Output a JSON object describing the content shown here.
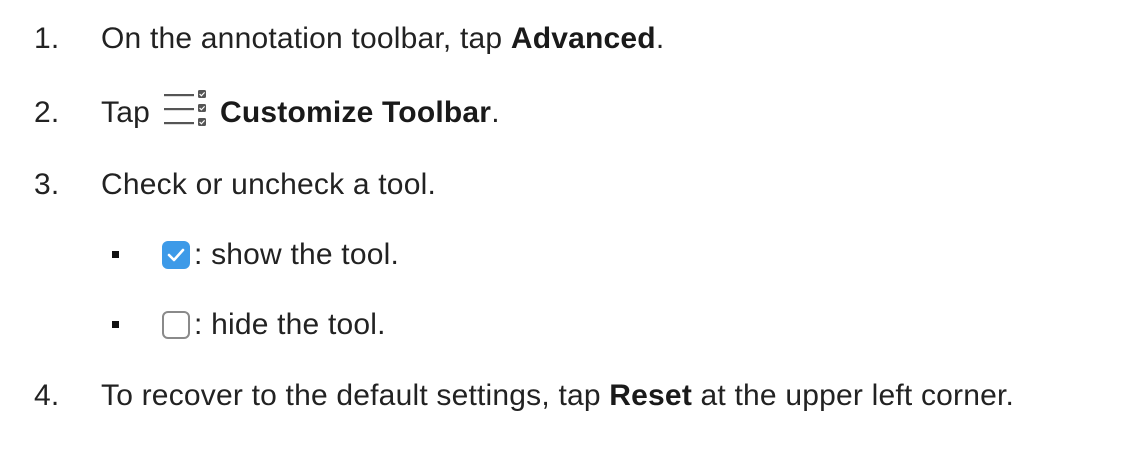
{
  "steps": [
    {
      "number": "1.",
      "before": "On the annotation toolbar, tap ",
      "bold": "Advanced",
      "after": "."
    },
    {
      "number": "2.",
      "before": "Tap",
      "icon": "customize-toolbar-icon",
      "bold": "Customize Toolbar",
      "after": "."
    },
    {
      "number": "3.",
      "text": "Check or uncheck a tool."
    },
    {
      "number": "4.",
      "before": "To recover to the default settings, tap ",
      "bold": "Reset",
      "after": " at the upper left corner."
    }
  ],
  "sub_items": [
    {
      "icon": "checked-checkbox-icon",
      "text": ": show the tool."
    },
    {
      "icon": "unchecked-checkbox-icon",
      "text": ": hide the tool."
    }
  ],
  "colors": {
    "text": "#222222",
    "checkbox_checked": "#3d9ae8",
    "checkbox_border": "#8a8a8a"
  }
}
